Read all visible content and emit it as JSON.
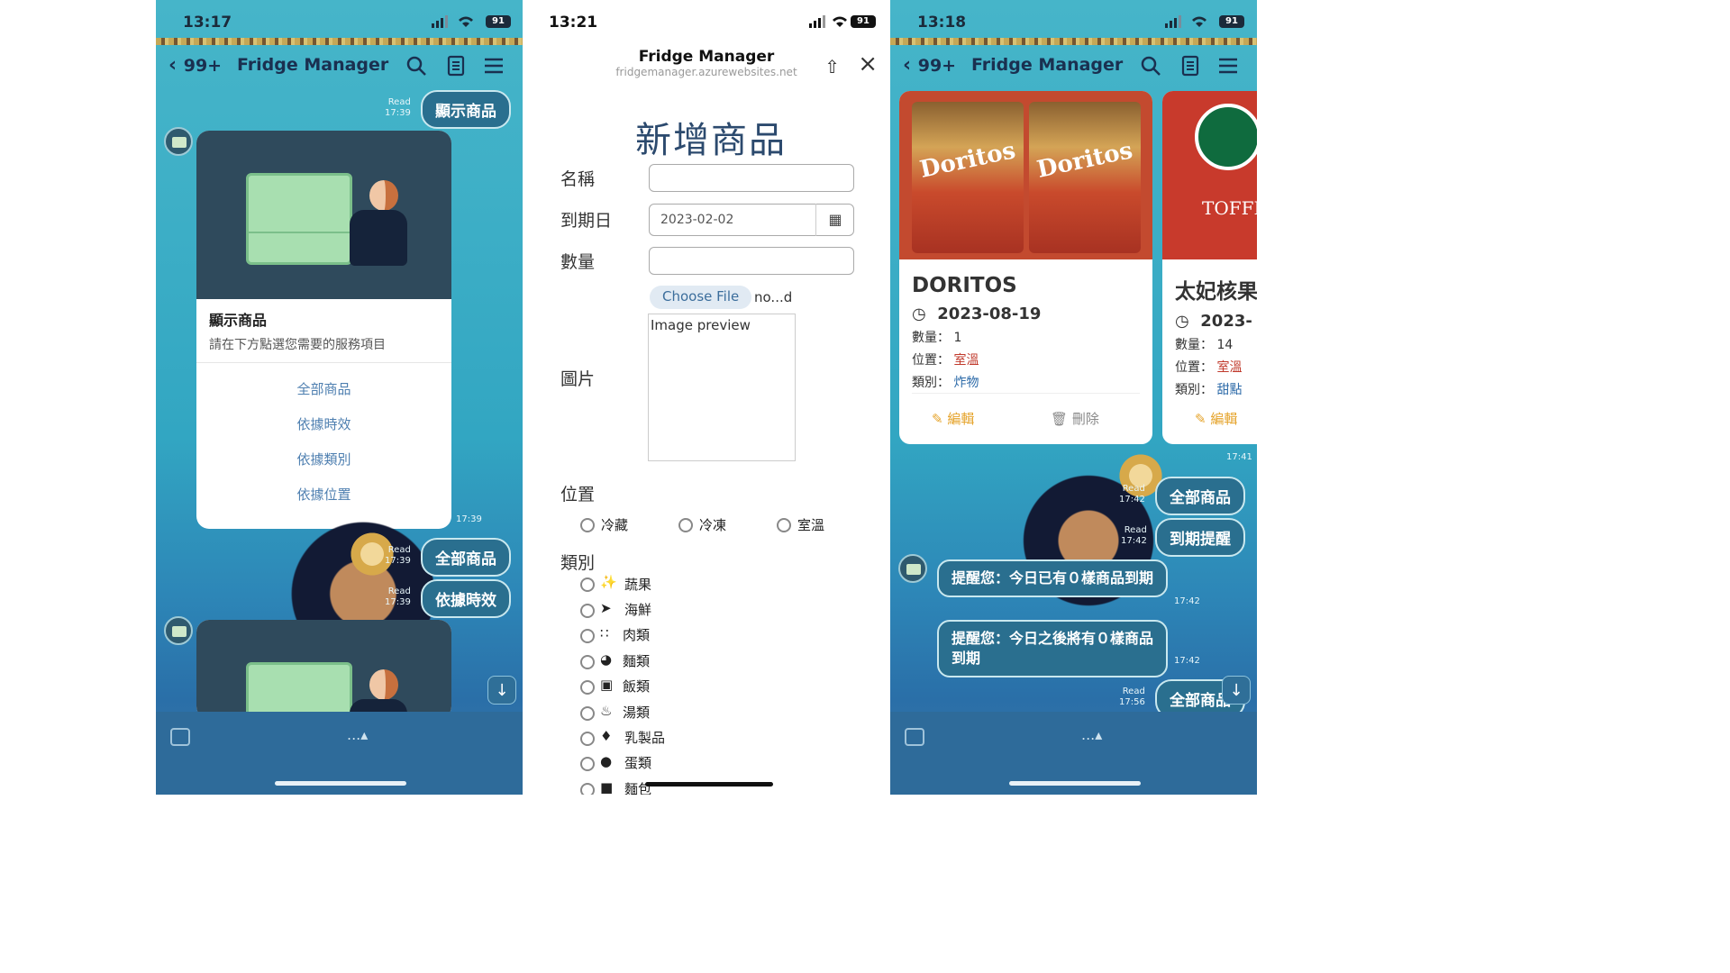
{
  "phone1": {
    "status": {
      "time": "13:17",
      "battery": "91"
    },
    "nav": {
      "back_count": "99+",
      "title": "Fridge Manager"
    },
    "messages": {
      "top_bubble": "顯示商品",
      "top_read": "Read",
      "top_time": "17:39",
      "card": {
        "header": "顯示商品",
        "subtitle": "請在下方點選您需要的服務項目",
        "links": [
          "全部商品",
          "依據時效",
          "依據類別",
          "依據位置"
        ],
        "time": "17:39"
      },
      "bubble_all": "全部商品",
      "bubble_all_read": "Read",
      "bubble_all_time": "17:39",
      "bubble_expiry": "依據時效",
      "bubble_expiry_read": "Read",
      "bubble_expiry_time": "17:39"
    },
    "bottom": {
      "more": "...▴"
    }
  },
  "phone2": {
    "status": {
      "time": "13:21",
      "battery": "91"
    },
    "browser": {
      "title": "Fridge Manager",
      "url": "fridgemanager.azurewebsites.net"
    },
    "form": {
      "title": "新增商品",
      "name_label": "名稱",
      "name_value": "",
      "expiry_label": "到期日",
      "expiry_value": "2023-02-02",
      "qty_label": "數量",
      "qty_value": "",
      "image_label": "圖片",
      "choose_file": "Choose File",
      "file_name": "no...d",
      "preview_text": "Image preview",
      "location_label": "位置",
      "locations": [
        "冷藏",
        "冷凍",
        "室溫"
      ],
      "category_label": "類別",
      "categories": [
        "蔬果",
        "海鮮",
        "肉類",
        "麵類",
        "飯類",
        "湯類",
        "乳製品",
        "蛋類",
        "麵包"
      ]
    }
  },
  "phone3": {
    "status": {
      "time": "13:18",
      "battery": "91"
    },
    "nav": {
      "back_count": "99+",
      "title": "Fridge Manager"
    },
    "products": [
      {
        "image_text": "Doritos",
        "name": "DORITOS",
        "date": "2023-08-19",
        "qty_label": "數量：",
        "qty": "1",
        "loc_label": "位置：",
        "loc": "室溫",
        "cat_label": "類別：",
        "cat": "炸物",
        "edit": "編輯",
        "delete": "刪除"
      },
      {
        "image_text": "TOFFEE",
        "name": "太妃核果",
        "date": "2023-",
        "qty_label": "數量：",
        "qty": "14",
        "loc_label": "位置：",
        "loc": "室溫",
        "cat_label": "類別：",
        "cat": "甜點",
        "edit": "編輯"
      }
    ],
    "messages": {
      "carousel_time": "17:41",
      "bubble_all": "全部商品",
      "read1": "Read",
      "time1": "17:42",
      "bubble_remind": "到期提醒",
      "read2": "Read",
      "time2": "17:42",
      "msg_today": "提醒您：今日已有０樣商品到期",
      "msg_today_time": "17:42",
      "msg_after": "提醒您：今日之後將有０樣商品到期",
      "msg_after_time": "17:42",
      "bubble_last": "全部商品",
      "read3": "Read",
      "time3": "17:56"
    },
    "bottom": {
      "more": "...▴"
    }
  },
  "colors": {
    "accent": "#2a6f8f",
    "link": "#4e7fb0",
    "location_red": "#c0392b",
    "category_blue": "#2c6aa8",
    "edit_orange": "#e5a32a"
  }
}
